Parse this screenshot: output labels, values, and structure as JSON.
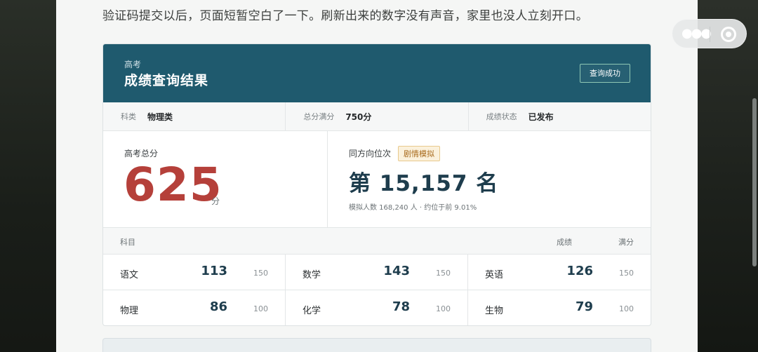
{
  "story": {
    "text": "验证码提交以后，页面短暂空白了一下。刷新出来的数字没有声音，家里也没人立刻开口。"
  },
  "card": {
    "kicker": "高考",
    "title": "成绩查询结果",
    "status": "查询成功",
    "meta": [
      {
        "key": "科类",
        "value": "物理类"
      },
      {
        "key": "总分满分",
        "value": "750分"
      },
      {
        "key": "成绩状态",
        "value": "已发布"
      }
    ],
    "total": {
      "label": "高考总分",
      "value": "625",
      "unit": "分"
    },
    "rank": {
      "label": "同方向位次",
      "tag": "剧情模拟",
      "text": "第 15,157 名",
      "sub": "模拟人数 168,240 人 · 约位于前 9.01%"
    },
    "subjects_header": {
      "subject": "科目",
      "score": "成绩",
      "full": "满分"
    },
    "subjects": [
      {
        "name": "语文",
        "score": "113",
        "full": "150"
      },
      {
        "name": "数学",
        "score": "143",
        "full": "150"
      },
      {
        "name": "英语",
        "score": "126",
        "full": "150"
      },
      {
        "name": "物理",
        "score": "86",
        "full": "100"
      },
      {
        "name": "化学",
        "score": "78",
        "full": "100"
      },
      {
        "name": "生物",
        "score": "79",
        "full": "100"
      }
    ]
  },
  "capsule": {
    "more_icon": "more-dots-icon",
    "close_icon": "close-miniprogram-icon"
  },
  "colors": {
    "header": "#1f5a6e",
    "total_score": "#b5403a",
    "rank_text": "#1e3d4d",
    "tag": "#a86a1c"
  }
}
